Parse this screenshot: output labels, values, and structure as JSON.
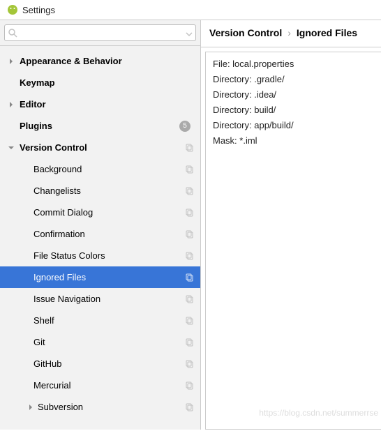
{
  "window": {
    "title": "Settings"
  },
  "search": {
    "placeholder": ""
  },
  "tree": {
    "items": [
      {
        "label": "Appearance & Behavior",
        "bold": true,
        "level": 1,
        "arrow": "right",
        "copy": false,
        "badge": null
      },
      {
        "label": "Keymap",
        "bold": true,
        "level": 1,
        "arrow": "none",
        "copy": false,
        "badge": null
      },
      {
        "label": "Editor",
        "bold": true,
        "level": 1,
        "arrow": "right",
        "copy": false,
        "badge": null
      },
      {
        "label": "Plugins",
        "bold": true,
        "level": 1,
        "arrow": "none",
        "copy": false,
        "badge": "5"
      },
      {
        "label": "Version Control",
        "bold": true,
        "level": 1,
        "arrow": "down",
        "copy": true,
        "badge": null
      },
      {
        "label": "Background",
        "bold": false,
        "level": 2,
        "arrow": "none",
        "copy": true,
        "badge": null
      },
      {
        "label": "Changelists",
        "bold": false,
        "level": 2,
        "arrow": "none",
        "copy": true,
        "badge": null
      },
      {
        "label": "Commit Dialog",
        "bold": false,
        "level": 2,
        "arrow": "none",
        "copy": true,
        "badge": null
      },
      {
        "label": "Confirmation",
        "bold": false,
        "level": 2,
        "arrow": "none",
        "copy": true,
        "badge": null
      },
      {
        "label": "File Status Colors",
        "bold": false,
        "level": 2,
        "arrow": "none",
        "copy": true,
        "badge": null
      },
      {
        "label": "Ignored Files",
        "bold": false,
        "level": 2,
        "arrow": "none",
        "copy": true,
        "badge": null,
        "selected": true
      },
      {
        "label": "Issue Navigation",
        "bold": false,
        "level": 2,
        "arrow": "none",
        "copy": true,
        "badge": null
      },
      {
        "label": "Shelf",
        "bold": false,
        "level": 2,
        "arrow": "none",
        "copy": true,
        "badge": null
      },
      {
        "label": "Git",
        "bold": false,
        "level": 2,
        "arrow": "none",
        "copy": true,
        "badge": null
      },
      {
        "label": "GitHub",
        "bold": false,
        "level": 2,
        "arrow": "none",
        "copy": true,
        "badge": null
      },
      {
        "label": "Mercurial",
        "bold": false,
        "level": 2,
        "arrow": "none",
        "copy": true,
        "badge": null
      },
      {
        "label": "Subversion",
        "bold": false,
        "level": 3,
        "arrow": "right",
        "copy": true,
        "badge": null
      }
    ]
  },
  "breadcrumb": {
    "part1": "Version Control",
    "part2": "Ignored Files"
  },
  "content": {
    "lines": [
      "File: local.properties",
      "Directory: .gradle/",
      "Directory: .idea/",
      "Directory: build/",
      "Directory: app/build/",
      "Mask: *.iml"
    ]
  },
  "watermark": "https://blog.csdn.net/summerrse"
}
